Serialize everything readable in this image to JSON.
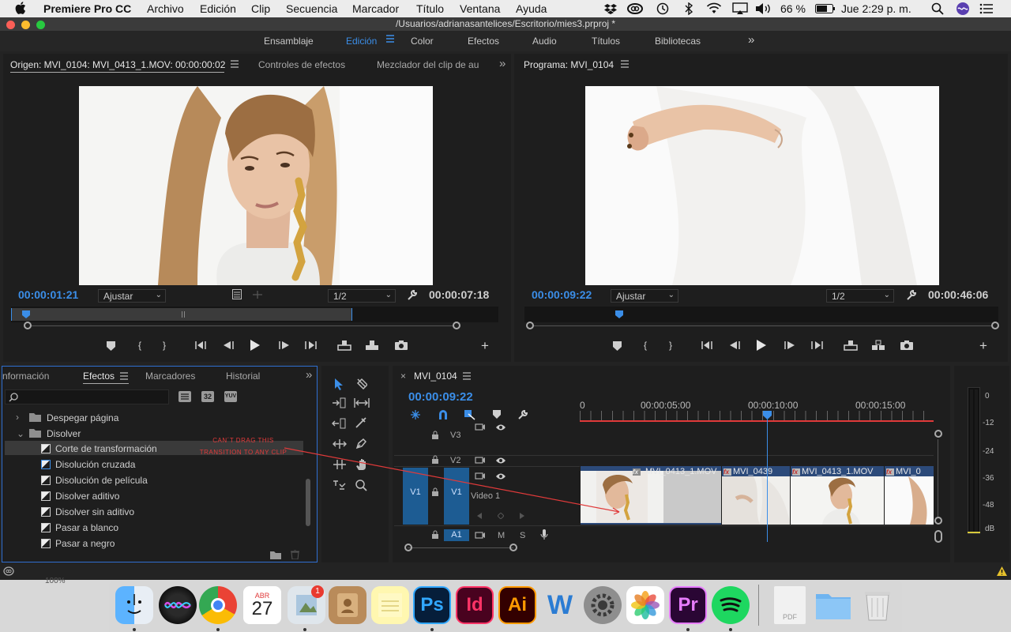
{
  "menubar": {
    "app": "Premiere Pro CC",
    "items": [
      "Archivo",
      "Edición",
      "Clip",
      "Secuencia",
      "Marcador",
      "Título",
      "Ventana",
      "Ayuda"
    ],
    "battery": "66 %",
    "clock": "Jue 2:29 p. m."
  },
  "window": {
    "title": "/Usuarios/adrianasantelices/Escritorio/mies3.prproj *"
  },
  "workspaces": {
    "items": [
      "Ensamblaje",
      "Edición",
      "Color",
      "Efectos",
      "Audio",
      "Títulos",
      "Bibliotecas"
    ],
    "active": "Edición",
    "more": "»"
  },
  "source": {
    "tab": "Origen: MVI_0104: MVI_0413_1.MOV: 00:00:00:02",
    "tab2": "Controles de efectos",
    "tab3": "Mezclador del clip de au",
    "more": "»",
    "timecode": "00:00:01:21",
    "fit": "Ajustar",
    "resolution": "1/2",
    "duration": "00:00:07:18",
    "playhead_fraction": 0.03
  },
  "program": {
    "tab": "Programa: MVI_0104",
    "timecode": "00:00:09:22",
    "fit": "Ajustar",
    "resolution": "1/2",
    "duration": "00:00:46:06",
    "playhead_fraction": 0.2
  },
  "effects": {
    "tabs": [
      "nformación",
      "Efectos",
      "Marcadores",
      "Historial"
    ],
    "active_tab": "Efectos",
    "more": "»",
    "search_placeholder": "",
    "filter_badges": [
      "32",
      "YUV"
    ],
    "tree": [
      {
        "label": "Despegar página",
        "type": "folder",
        "expanded": false
      },
      {
        "label": "Disolver",
        "type": "folder",
        "expanded": true
      },
      {
        "label": "Corte de transformación",
        "type": "effect",
        "selected": true
      },
      {
        "label": "Disolución cruzada",
        "type": "effect",
        "selected": false
      },
      {
        "label": "Disolución de película",
        "type": "effect",
        "selected": false
      },
      {
        "label": "Disolver aditivo",
        "type": "effect",
        "selected": false
      },
      {
        "label": "Disolver sin aditivo",
        "type": "effect",
        "selected": false
      },
      {
        "label": "Pasar a blanco",
        "type": "effect",
        "selected": false
      },
      {
        "label": "Pasar a negro",
        "type": "effect",
        "selected": false
      }
    ],
    "annotation_line1": "CAN´T DRAG THIS",
    "annotation_line2": "TRANSITION TO ANY CLIP"
  },
  "timeline": {
    "close": "×",
    "tab": "MVI_0104",
    "timecode": "00:00:09:22",
    "ruler": [
      "0",
      "00:00:05:00",
      "00:00:10:00",
      "00:00:15:00"
    ],
    "tracks": {
      "v3": "V3",
      "v2": "V2",
      "v1": "V1",
      "v1_source": "V1",
      "v1_name": "Video 1",
      "a1": "A1",
      "mute": "M",
      "solo": "S"
    },
    "clips": [
      "MVI_0413_1.MOV",
      "MVI_0439",
      "MVI_0413_1.MOV",
      "MVI_0"
    ],
    "accent_color": "#3b8ee8",
    "in_out_color": "#e03a3a"
  },
  "meter": {
    "scale": [
      "0",
      "-12",
      "-24",
      "-36",
      "-48",
      "dB"
    ]
  },
  "status": {
    "zoom_behind": "100%"
  },
  "dock": {
    "apps": [
      "Finder",
      "Siri",
      "Chrome",
      "Calendar",
      "Preview",
      "Contacts",
      "Notes",
      "Photoshop",
      "InDesign",
      "Illustrator",
      "Word",
      "System Preferences",
      "Photos",
      "Premiere Pro",
      "Spotify",
      "PDF",
      "Folder",
      "Trash"
    ],
    "calendar_month": "ABR",
    "calendar_day": "27",
    "badge": "1",
    "ps": "Ps",
    "id": "Id",
    "ai": "Ai",
    "w": "W",
    "pr": "Pr",
    "pdf": "PDF"
  }
}
